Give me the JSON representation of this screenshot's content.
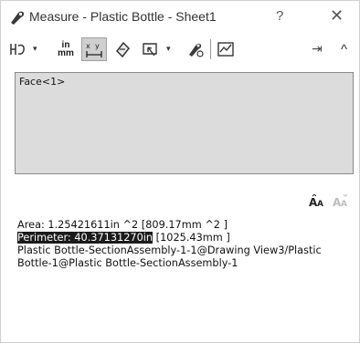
{
  "window": {
    "title": "Measure - Plastic Bottle - Sheet1",
    "help_label": "?",
    "close_label": "✕"
  },
  "toolbar": {
    "units_label_top": "in",
    "units_label_bottom": "mm",
    "dropdown_caret": "▾",
    "pin_label": "⇥",
    "collapse_label": "^"
  },
  "selection": {
    "items": [
      "Face<1>"
    ]
  },
  "results": {
    "area_line": "Area: 1.25421611in ^2  [809.17mm ^2 ]",
    "perimeter_highlight": "Perimeter: 40.37131270in",
    "perimeter_rest": "  [1025.43mm ]",
    "entity_line": "Plastic Bottle-SectionAssembly-1-1@Drawing View3/Plastic Bottle-1@Plastic Bottle-SectionAssembly-1"
  },
  "colors": {
    "selection_bg": "#dcdcdc",
    "active_tool_bg": "#cfcfcf",
    "highlight_bg": "#1b1b1b"
  }
}
